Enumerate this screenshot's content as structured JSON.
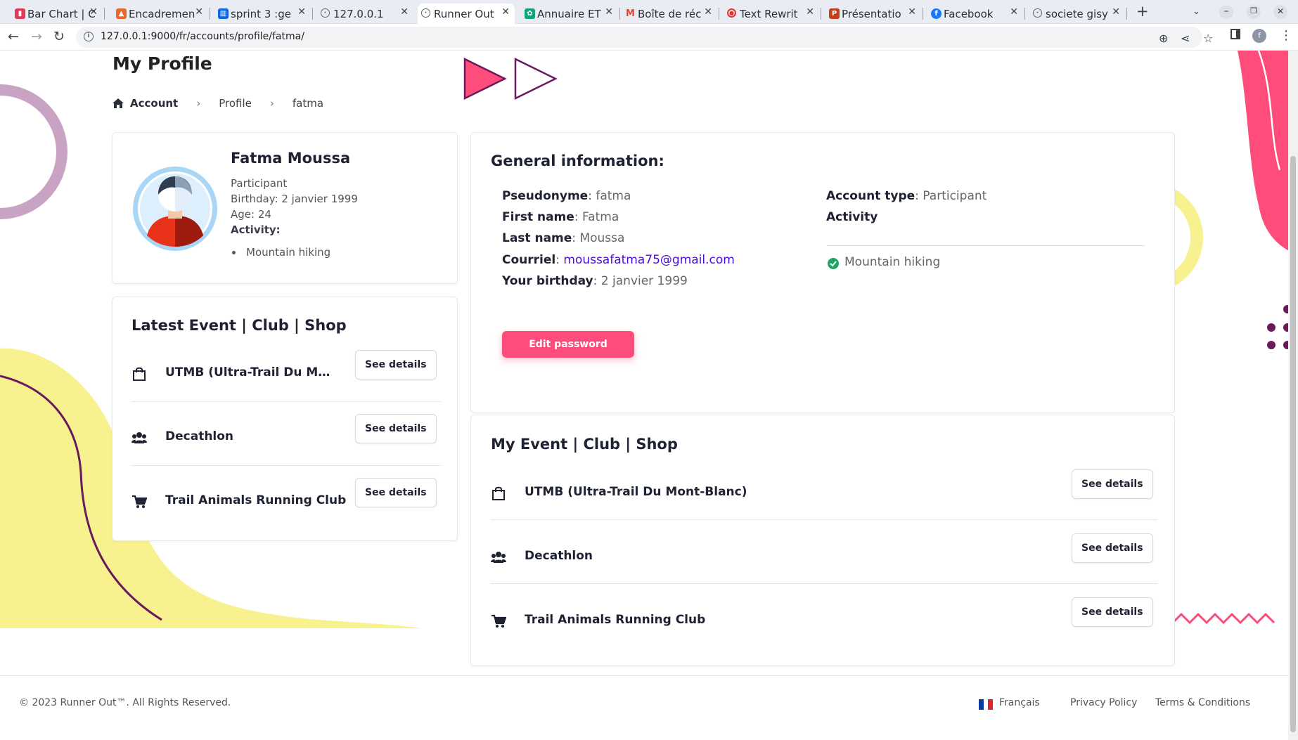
{
  "browser": {
    "tabs": [
      {
        "label": "Bar Chart | C",
        "icon": "bar-chart-favicon",
        "color": "#e03a5b"
      },
      {
        "label": "Encadremen",
        "icon": "encadrement-favicon",
        "color": "#e8692a"
      },
      {
        "label": "sprint 3 :ge",
        "icon": "trello-favicon",
        "color": "#0c66e4"
      },
      {
        "label": "127.0.0.1",
        "icon": "globe-favicon",
        "color": "#5f6368"
      },
      {
        "label": "Runner Out",
        "icon": "globe-favicon",
        "color": "#5f6368"
      },
      {
        "label": "Annuaire ET",
        "icon": "chatgpt-favicon",
        "color": "#10a37f"
      },
      {
        "label": "Boîte de réc",
        "icon": "gmail-favicon",
        "color": "#ea4335"
      },
      {
        "label": "Text Rewrit",
        "icon": "rewriter-favicon",
        "color": "#e2332e"
      },
      {
        "label": "Présentatio",
        "icon": "powerpoint-favicon",
        "color": "#c43e1c"
      },
      {
        "label": "Facebook",
        "icon": "facebook-favicon",
        "color": "#1877f2"
      },
      {
        "label": "societe gisy",
        "icon": "globe-favicon",
        "color": "#5f6368"
      }
    ],
    "active_tab_index": 4,
    "url": "127.0.0.1:9000/fr/accounts/profile/fatma/",
    "profile_initial": "f"
  },
  "page": {
    "title": "My Profile",
    "breadcrumb": [
      "Account",
      "Profile",
      "fatma"
    ]
  },
  "profile_card": {
    "name": "Fatma Moussa",
    "role": "Participant",
    "birthday": "Birthday: 2 janvier 1999",
    "age": "Age: 24",
    "activity_label": "Activity:",
    "activities": [
      "Mountain hiking"
    ]
  },
  "latest_card": {
    "title": "Latest Event | Club | Shop",
    "items": [
      {
        "name": "UTMB (Ultra-Trail Du Mont-Blanc)",
        "icon": "shopping-bag-icon",
        "button": "See details"
      },
      {
        "name": "Decathlon",
        "icon": "group-icon",
        "button": "See details"
      },
      {
        "name": "Trail Animals Running Club",
        "icon": "shopping-cart-icon",
        "button": "See details"
      }
    ]
  },
  "general": {
    "title": "General information:",
    "fields": [
      {
        "label": "Pseudonyme",
        "value": "fatma"
      },
      {
        "label": "First name",
        "value": "Fatma"
      },
      {
        "label": "Last name",
        "value": "Moussa"
      },
      {
        "label": "Courriel",
        "value": "moussafatma75@gmail.com"
      },
      {
        "label": "Your birthday",
        "value": "2 janvier 1999"
      }
    ],
    "account_type_label": "Account type",
    "account_type_value": "Participant",
    "activity_heading": "Activity",
    "activities": [
      "Mountain hiking"
    ],
    "edit_password": "Edit password"
  },
  "my_card": {
    "title": "My Event | Club | Shop",
    "items": [
      {
        "name": "UTMB (Ultra-Trail Du Mont-Blanc)",
        "icon": "shopping-bag-icon",
        "button": "See details"
      },
      {
        "name": "Decathlon",
        "icon": "group-icon",
        "button": "See details"
      },
      {
        "name": "Trail Animals Running Club",
        "icon": "shopping-cart-icon",
        "button": "See details"
      }
    ]
  },
  "footer": {
    "copyright": "© 2023 Runner Out™. All Rights Reserved.",
    "language": "Français",
    "privacy": "Privacy Policy",
    "terms": "Terms & Conditions"
  },
  "colors": {
    "accent_pink": "#ff4d7b",
    "yellow_blob": "#f7f28f",
    "purple": "#6a1a5c",
    "link": "#4b0cd9",
    "check_green": "#1fa463"
  }
}
